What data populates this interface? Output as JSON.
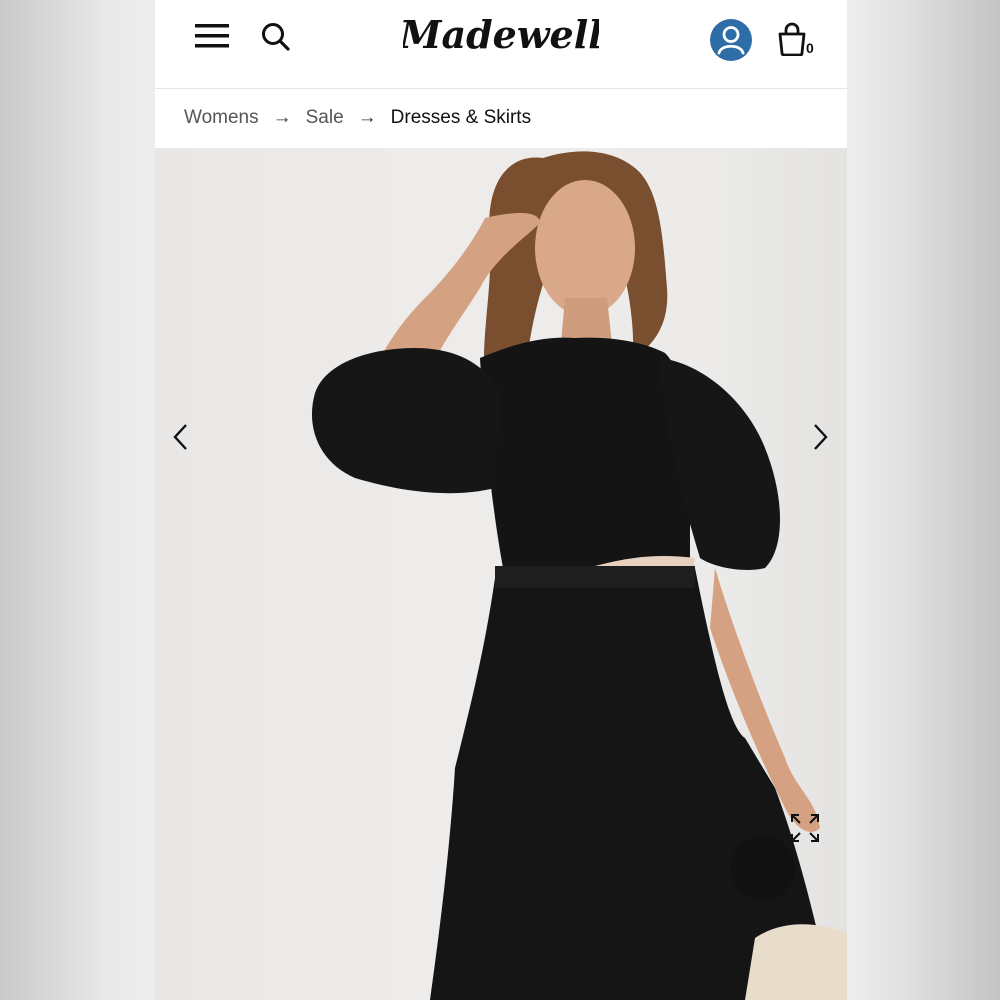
{
  "header": {
    "brand": "Madewell",
    "icons": {
      "menu": "hamburger-menu-icon",
      "search": "search-icon",
      "account": "account-icon",
      "bag": "shopping-bag-icon"
    },
    "bag_count": "0",
    "account_color": "#2e6ea6"
  },
  "breadcrumb": {
    "items": [
      {
        "label": "Womens"
      },
      {
        "label": "Sale"
      },
      {
        "label": "Dresses & Skirts"
      }
    ],
    "separator": "→"
  },
  "gallery": {
    "prev_icon": "chevron-left-icon",
    "next_icon": "chevron-right-icon",
    "expand_icon": "expand-icon"
  }
}
